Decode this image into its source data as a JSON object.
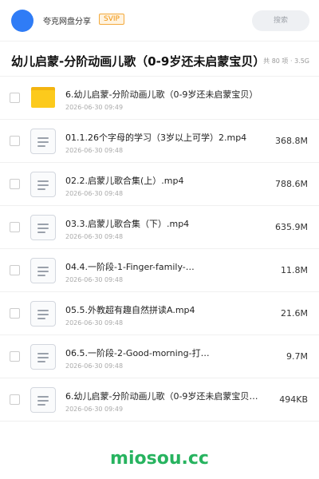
{
  "header": {
    "app_name": "夸克网盘分享",
    "badge": "SVIP",
    "search_label": "搜索",
    "avatar_color": "#2f7cf6",
    "badge_color": "#f0930b"
  },
  "share": {
    "title": "幼儿启蒙-分阶动画儿歌（0-9岁还未启蒙宝贝）",
    "meta": "共 80 项 · 3.5G"
  },
  "files": [
    {
      "type": "folder",
      "name": "6.幼儿启蒙-分阶动画儿歌（0-9岁还未启蒙宝贝）",
      "date": "2026-06-30 09:49",
      "size": ""
    },
    {
      "type": "file",
      "name": "01.1.26个字母的学习（3岁以上可学）2.mp4",
      "date": "2026-06-30 09:48",
      "size": "368.8M"
    },
    {
      "type": "file",
      "name": "02.2.启蒙儿歌合集(上）.mp4",
      "date": "2026-06-30 09:48",
      "size": "788.6M"
    },
    {
      "type": "file",
      "name": "03.3.启蒙儿歌合集（下）.mp4",
      "date": "2026-06-30 09:48",
      "size": "635.9M"
    },
    {
      "type": "file",
      "name": "04.4.一阶段-1-Finger-family-…",
      "date": "2026-06-30 09:48",
      "size": "11.8M"
    },
    {
      "type": "file",
      "name": "05.5.外教超有趣自然拼读A.mp4",
      "date": "2026-06-30 09:48",
      "size": "21.6M"
    },
    {
      "type": "file",
      "name": "06.5.一阶段-2-Good-morning-打…",
      "date": "2026-06-30 09:48",
      "size": "9.7M"
    },
    {
      "type": "file",
      "name": "6.幼儿启蒙-分阶动画儿歌（0-9岁还未启蒙宝贝）…",
      "date": "2026-06-30 09:49",
      "size": "494KB"
    }
  ],
  "watermark": "miosou.cc",
  "watermark_color": "#27b35f"
}
